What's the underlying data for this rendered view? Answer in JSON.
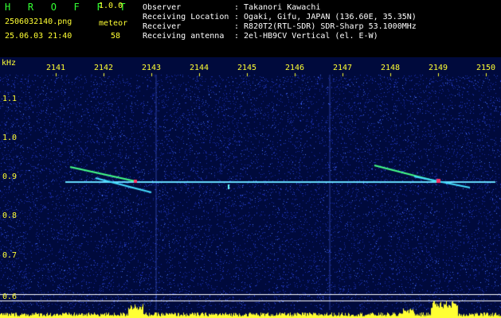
{
  "header": {
    "app_logo": "H R O F F T",
    "version": "1.0.0",
    "file_name": "2506032140.png",
    "meteor_label": "meteor",
    "timestamp": "25.06.03 21:40",
    "meteor_count": "58",
    "observer_label": "Observer",
    "observer_value": ": Takanori Kawachi",
    "location_label": "Receiving Location",
    "location_value": ": Ogaki, Gifu, JAPAN (136.60E, 35.35N)",
    "receiver_label": "Receiver",
    "receiver_value": ": R820T2(RTL-SDR) SDR-Sharp 53.1000MHz",
    "antenna_label": "Receiving antenna",
    "antenna_value": ": 2el-HB9CV Vertical (el. E-W)"
  },
  "axes": {
    "y_unit": "kHz",
    "y_ticks": [
      "1.1",
      "1.0",
      "0.9",
      "0.8",
      "0.7",
      "0.6"
    ],
    "x_ticks": [
      "2141",
      "2142",
      "2143",
      "2144",
      "2145",
      "2146",
      "2147",
      "2148",
      "2149",
      "2150"
    ]
  },
  "colors": {
    "background": "#000000",
    "spectrum_bg": "#000a3c",
    "header_green": "#33ff33",
    "header_yellow": "#ffff33",
    "carrier": "#66ddff",
    "meteor_hot": "#ff3366"
  }
}
